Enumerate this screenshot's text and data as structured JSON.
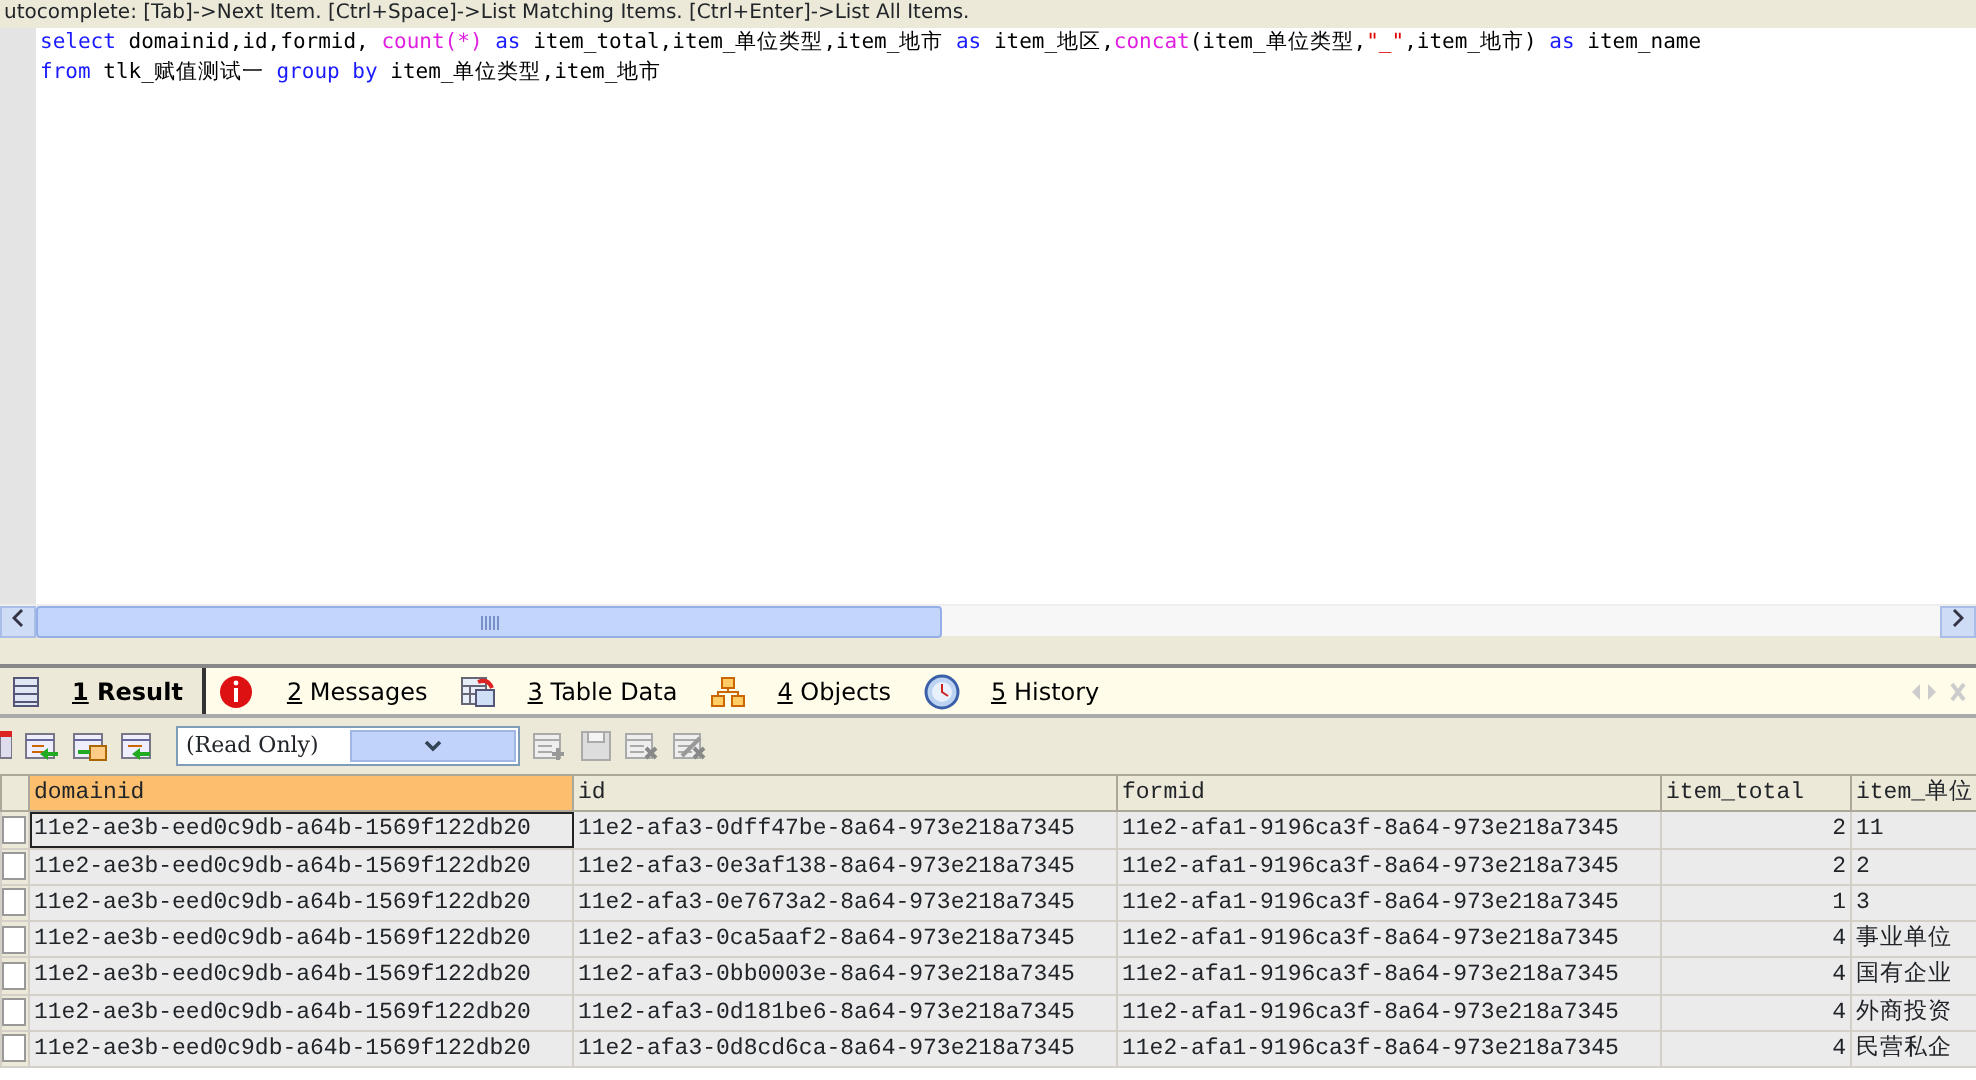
{
  "hint_bar": {
    "text": "utocomplete: [Tab]->Next Item. [Ctrl+Space]->List Matching Items. [Ctrl+Enter]->List All Items."
  },
  "editor": {
    "lines": [
      [
        {
          "kind": "keyword",
          "text": "select"
        },
        {
          "kind": "plain",
          "text": " domainid,id,formid, "
        },
        {
          "kind": "function",
          "text": "count(*) "
        },
        {
          "kind": "keyword",
          "text": "as"
        },
        {
          "kind": "plain",
          "text": " item_total,item_单位类型,item_地市 "
        },
        {
          "kind": "keyword",
          "text": "as"
        },
        {
          "kind": "plain",
          "text": " item_地区,"
        },
        {
          "kind": "function",
          "text": "concat"
        },
        {
          "kind": "plain",
          "text": "(item_单位类型,"
        },
        {
          "kind": "string",
          "text": "\"_\""
        },
        {
          "kind": "plain",
          "text": ",item_地市) "
        },
        {
          "kind": "keyword",
          "text": "as"
        },
        {
          "kind": "plain",
          "text": " item_name"
        }
      ],
      [
        {
          "kind": "keyword",
          "text": "from"
        },
        {
          "kind": "plain",
          "text": " tlk_赋值测试一 "
        },
        {
          "kind": "keyword",
          "text": "group by"
        },
        {
          "kind": "plain",
          "text": " item_单位类型,item_地市"
        }
      ]
    ]
  },
  "tabs": [
    {
      "number": "1",
      "label": "Result",
      "selected": true
    },
    {
      "number": "2",
      "label": "Messages",
      "selected": false
    },
    {
      "number": "3",
      "label": "Table Data",
      "selected": false
    },
    {
      "number": "4",
      "label": "Objects",
      "selected": false
    },
    {
      "number": "5",
      "label": "History",
      "selected": false
    }
  ],
  "toolbar": {
    "mode_select": {
      "value": "(Read Only)"
    }
  },
  "table": {
    "columns": [
      {
        "label": "domainid",
        "selected": true
      },
      {
        "label": "id",
        "selected": false
      },
      {
        "label": "formid",
        "selected": false
      },
      {
        "label": "item_total",
        "selected": false
      },
      {
        "label": "item_单位",
        "selected": false
      }
    ],
    "rows": [
      {
        "selected": true,
        "cells": [
          "11e2-ae3b-eed0c9db-a64b-1569f122db20",
          "11e2-afa3-0dff47be-8a64-973e218a7345",
          "11e2-afa1-9196ca3f-8a64-973e218a7345",
          "2",
          "11"
        ]
      },
      {
        "selected": false,
        "cells": [
          "11e2-ae3b-eed0c9db-a64b-1569f122db20",
          "11e2-afa3-0e3af138-8a64-973e218a7345",
          "11e2-afa1-9196ca3f-8a64-973e218a7345",
          "2",
          "2"
        ]
      },
      {
        "selected": false,
        "cells": [
          "11e2-ae3b-eed0c9db-a64b-1569f122db20",
          "11e2-afa3-0e7673a2-8a64-973e218a7345",
          "11e2-afa1-9196ca3f-8a64-973e218a7345",
          "1",
          "3"
        ]
      },
      {
        "selected": false,
        "cells": [
          "11e2-ae3b-eed0c9db-a64b-1569f122db20",
          "11e2-afa3-0ca5aaf2-8a64-973e218a7345",
          "11e2-afa1-9196ca3f-8a64-973e218a7345",
          "4",
          "事业单位"
        ]
      },
      {
        "selected": false,
        "cells": [
          "11e2-ae3b-eed0c9db-a64b-1569f122db20",
          "11e2-afa3-0bb0003e-8a64-973e218a7345",
          "11e2-afa1-9196ca3f-8a64-973e218a7345",
          "4",
          "国有企业"
        ]
      },
      {
        "selected": false,
        "cells": [
          "11e2-ae3b-eed0c9db-a64b-1569f122db20",
          "11e2-afa3-0d181be6-8a64-973e218a7345",
          "11e2-afa1-9196ca3f-8a64-973e218a7345",
          "4",
          "外商投资"
        ]
      },
      {
        "selected": false,
        "cells": [
          "11e2-ae3b-eed0c9db-a64b-1569f122db20",
          "11e2-afa3-0d8cd6ca-8a64-973e218a7345",
          "11e2-afa1-9196ca3f-8a64-973e218a7345",
          "4",
          "民营私企"
        ]
      }
    ]
  }
}
